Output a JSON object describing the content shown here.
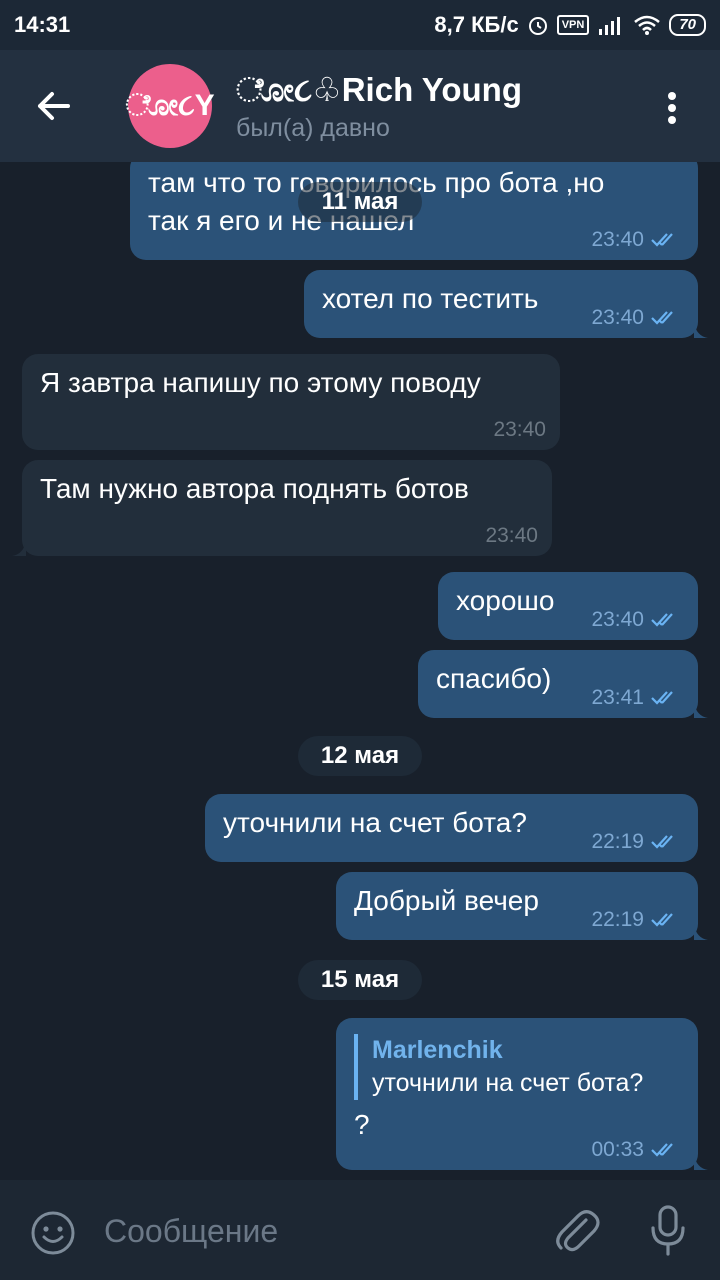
{
  "status_bar": {
    "time": "14:31",
    "net_speed": "8,7 КБ/с",
    "vpn": "VPN",
    "battery": "70"
  },
  "header": {
    "avatar_text": "ೋ૮Y",
    "name": "ೋ૮♧Rich Young",
    "status": "был(а) давно"
  },
  "messages": [
    {
      "text": "там что то говорилось про бота ,но\nтак я его и не нашел",
      "time": "23:40"
    },
    {
      "text": "хотел по тестить",
      "time": "23:40"
    },
    {
      "text": "Я завтра напишу по этому поводу",
      "time": "23:40"
    },
    {
      "text": "Там нужно автора поднять ботов",
      "time": "23:40"
    },
    {
      "text": "хорошо",
      "time": "23:40"
    },
    {
      "text": "спасибо)",
      "time": "23:41"
    },
    {
      "text": "уточнили на счет бота?",
      "time": "22:19"
    },
    {
      "text": "Добрый вечер",
      "time": "22:19"
    },
    {
      "reply_author": "Marlenchik",
      "reply_text": "уточнили на счет бота?",
      "text": "?",
      "time": "00:33"
    }
  ],
  "dates": [
    "11 мая",
    "12 мая",
    "15 мая"
  ],
  "input": {
    "placeholder": "Сообщение"
  },
  "icons": [
    "back-arrow-icon",
    "more-vertical-icon",
    "double-check-icon",
    "emoji-icon",
    "attach-icon",
    "mic-icon"
  ],
  "colors": {
    "background": "#18202b",
    "header": "#233040",
    "outgoing_bubble": "#2b5278",
    "incoming_bubble": "#222e3b",
    "accent": "#6ab3f3",
    "avatar": "#ec5f8c"
  }
}
